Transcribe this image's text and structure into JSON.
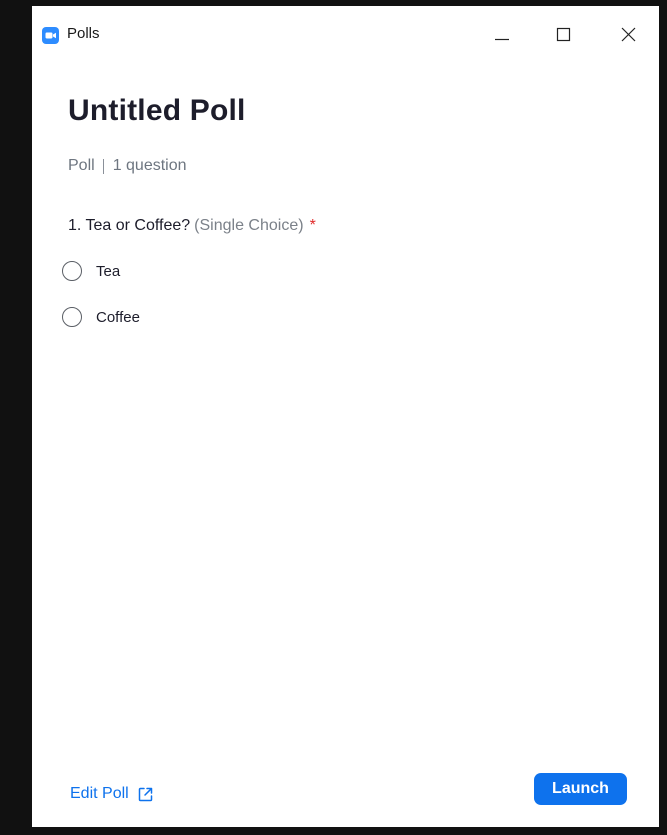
{
  "window": {
    "title": "Polls",
    "app_icon": "zoom-video-camera-icon",
    "controls": [
      "minimize-icon",
      "maximize-icon",
      "close-icon"
    ]
  },
  "poll": {
    "title": "Untitled Poll",
    "type": "Poll",
    "question_count": "1 question"
  },
  "question": {
    "text": "1. Tea or Coffee?",
    "type_hint": "(Single Choice)",
    "required_mark": "*",
    "options": [
      {
        "label": "Tea",
        "selected": false
      },
      {
        "label": "Coffee",
        "selected": false
      }
    ]
  },
  "footer": {
    "edit_label": "Edit Poll",
    "edit_icon": "external-link-icon",
    "launch_label": "Launch"
  },
  "colors": {
    "accent": "#0e72ed",
    "required": "#e02828",
    "app_icon": "#2d8cff"
  }
}
